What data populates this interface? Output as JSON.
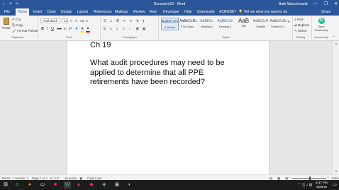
{
  "title_bar": {
    "document_title": "Document16 - Word",
    "user": "Barb Wanchwaedt",
    "window_buttons": [
      "—",
      "❐",
      "✕"
    ]
  },
  "tabs": [
    "File",
    "Home",
    "Insert",
    "Draw",
    "Design",
    "Layout",
    "References",
    "Mailings",
    "Review",
    "View",
    "Developer",
    "Help",
    "Grammarly",
    "ACROBAT"
  ],
  "tell_me": "Tell me what you want to do",
  "share": "Share",
  "ribbon": {
    "clipboard": {
      "paste": "Paste",
      "cut": "Cut",
      "copy": "Copy",
      "format_painter": "Format Painter",
      "label": "Clipboard"
    },
    "font": {
      "font_name": "Arial Black",
      "font_size": "14",
      "label": "Font",
      "buttons": [
        "B",
        "I",
        "U",
        "abc",
        "x₂",
        "x²",
        "A",
        "A",
        "A"
      ]
    },
    "paragraph": {
      "label": "Paragraph"
    },
    "styles": {
      "label": "Styles",
      "items": [
        {
          "preview": "AaBbCcDc",
          "name": "¶ Normal"
        },
        {
          "preview": "AaBbCcDc",
          "name": "¶ No Spac..."
        },
        {
          "preview": "AaBbCc",
          "name": "Heading 1"
        },
        {
          "preview": "AaBbCcE",
          "name": "Heading 2"
        },
        {
          "preview": "AaB",
          "name": "Title"
        },
        {
          "preview": "AaBbCcE",
          "name": "Subtitle"
        },
        {
          "preview": "AaBbCcDc",
          "name": "Subtle Em..."
        }
      ]
    },
    "editing": {
      "find": "Find",
      "replace": "Replace",
      "select": "Select",
      "label": "Editing"
    },
    "grammarly": {
      "open": "Open Grammarly",
      "label": "Grammarly"
    }
  },
  "document": {
    "chapter": "Ch 19",
    "question": "What audit procedures may need to be applied to determine that all PPE retirements have been recorded?"
  },
  "status_bar": {
    "page": "PAGE: 1",
    "section": "Section: 1",
    "page_of": "Page 1 of 1",
    "at": "At: 2.3\"",
    "words": "19 words",
    "caps": "Caps Lock",
    "zoom": "100%",
    "zoom_fraction": 0.5
  },
  "taskbar": {
    "time": "5:47 PM",
    "date": "4/29/18"
  }
}
